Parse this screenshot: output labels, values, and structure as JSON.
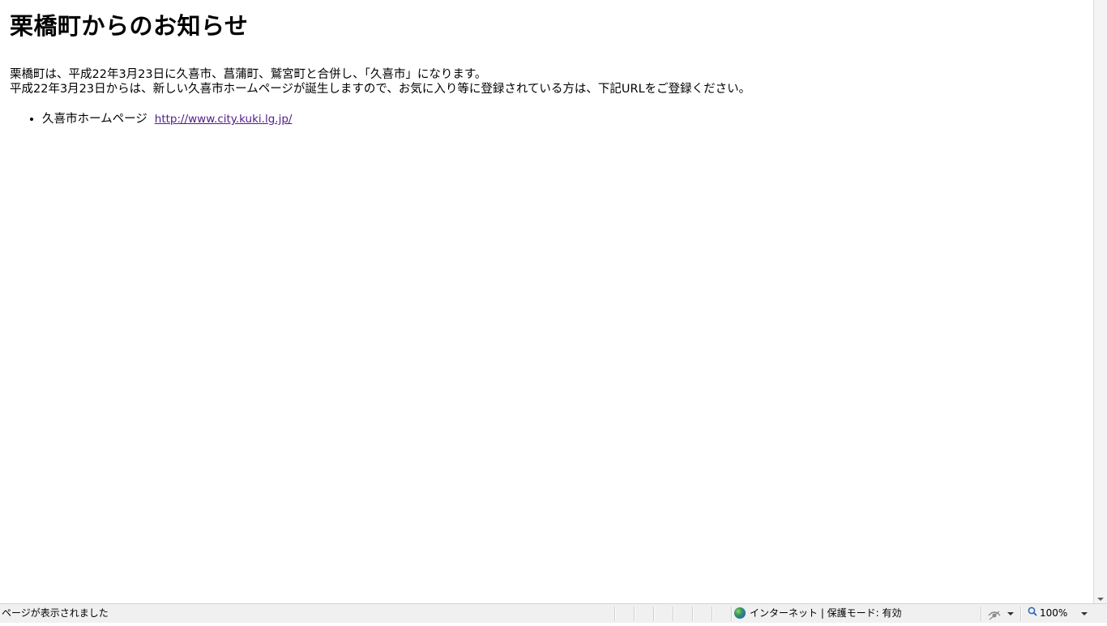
{
  "page": {
    "title": "栗橋町からのお知らせ",
    "notice_lines": [
      "栗橋町は、平成22年3月23日に久喜市、菖蒲町、鷲宮町と合併し、「久喜市」になります。",
      "平成22年3月23日からは、新しい久喜市ホームページが誕生しますので、お気に入り等に登録されている方は、下記URLをご登録ください。"
    ],
    "links": [
      {
        "label": "久喜市ホームページ",
        "url_text": "http://www.city.kuki.lg.jp/"
      }
    ]
  },
  "statusbar": {
    "status_text": "ページが表示されました",
    "zone_icon": "globe-icon",
    "zone_text": "インターネット | 保護モード: 有効",
    "privacy_icon": "privacy-eye-icon",
    "zoom_icon": "zoom-magnifier-icon",
    "zoom_level": "100%"
  },
  "colors": {
    "link_visited": "#551a8b",
    "statusbar_bg": "#f0f0f0"
  }
}
